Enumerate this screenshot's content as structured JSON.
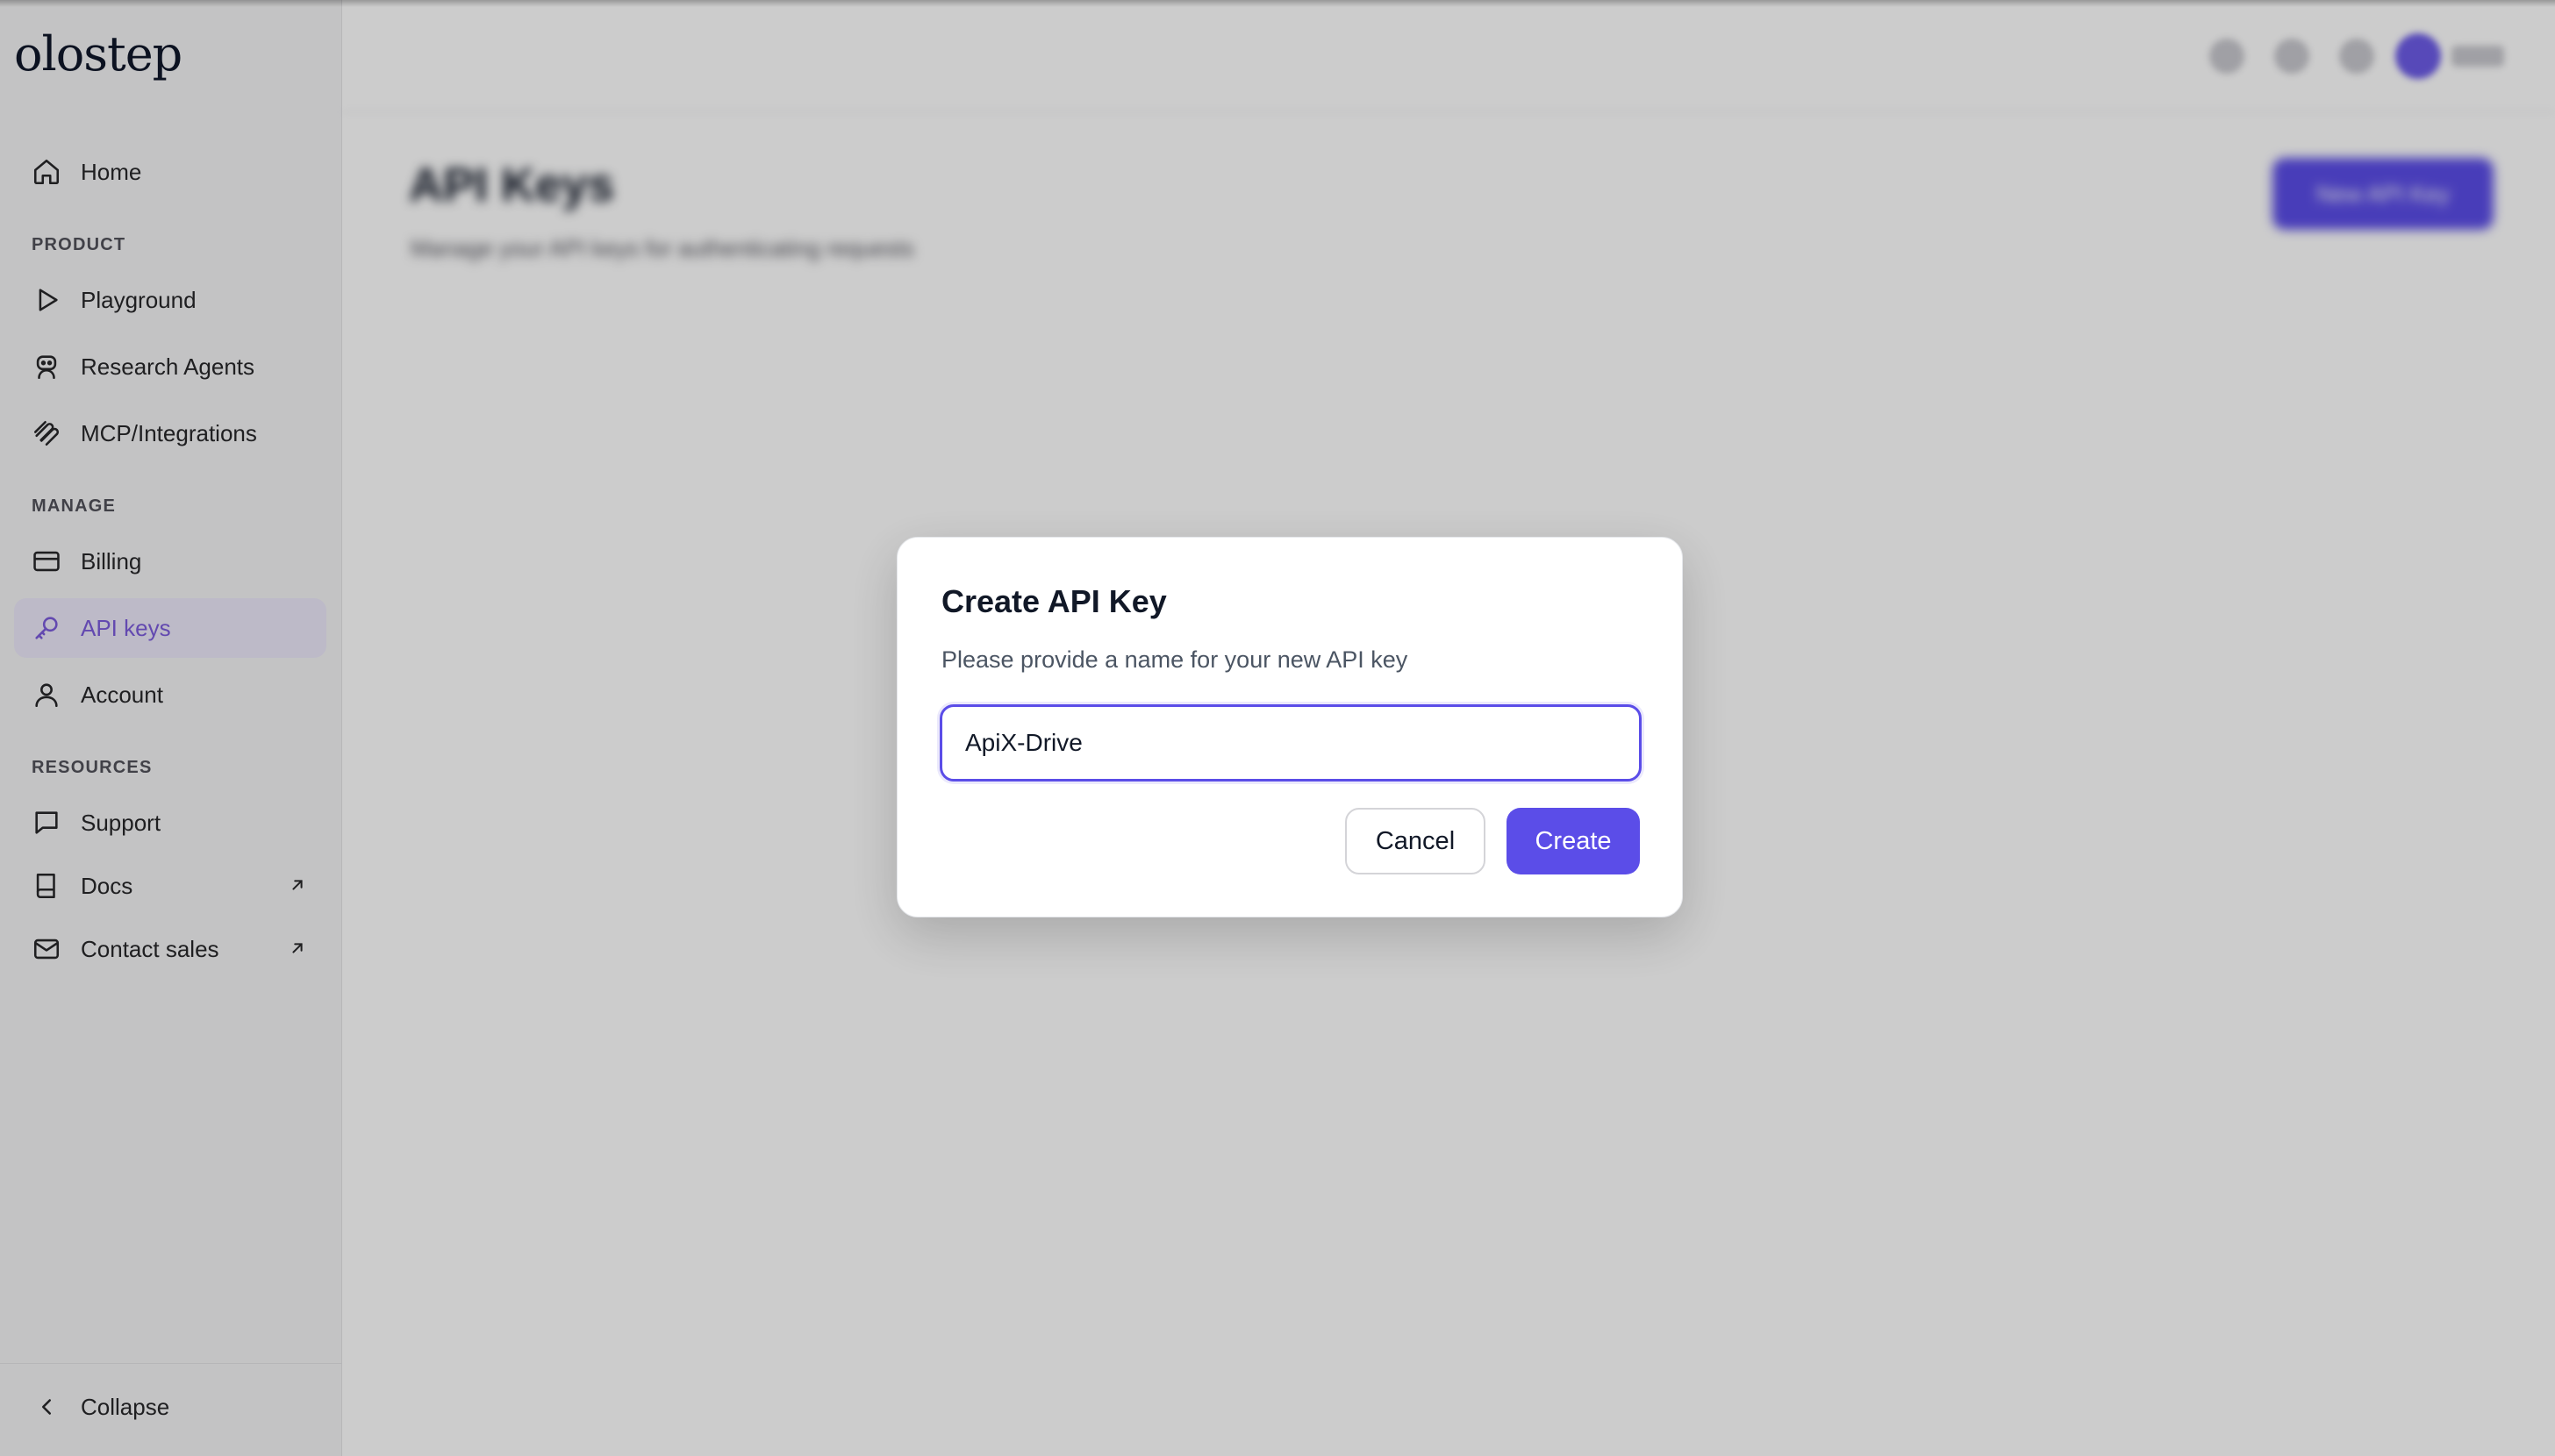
{
  "sidebar": {
    "logo": "olostep",
    "home_label": "Home",
    "sections": {
      "product": "PRODUCT",
      "manage": "MANAGE",
      "resources": "RESOURCES"
    },
    "items": {
      "playground": "Playground",
      "research_agents": "Research Agents",
      "mcp_integrations": "MCP/Integrations",
      "billing": "Billing",
      "api_keys": "API keys",
      "account": "Account",
      "support": "Support",
      "docs": "Docs",
      "contact_sales": "Contact sales"
    },
    "active_item": "API keys",
    "collapse_label": "Collapse"
  },
  "background": {
    "page_title": "API Keys",
    "page_subtitle": "Manage your API keys for authenticating requests",
    "new_key_button": "New API Key"
  },
  "modal": {
    "title": "Create API Key",
    "description": "Please provide a name for your new API key",
    "input_value": "ApiX-Drive",
    "cancel_label": "Cancel",
    "create_label": "Create"
  },
  "colors": {
    "accent": "#5b4de8",
    "active_bg": "#ede9fb",
    "active_text": "#7c5cdc",
    "sidebar_bg": "#f4f4f5"
  },
  "icons": {
    "home": "home-icon",
    "playground": "play-icon",
    "research_agents": "robot-icon",
    "mcp_integrations": "integration-icon",
    "billing": "credit-card-icon",
    "api_keys": "key-icon",
    "account": "user-icon",
    "support": "message-square-icon",
    "docs": "book-icon",
    "contact_sales": "mail-icon",
    "external": "arrow-up-right-icon",
    "collapse": "chevron-left-icon"
  }
}
